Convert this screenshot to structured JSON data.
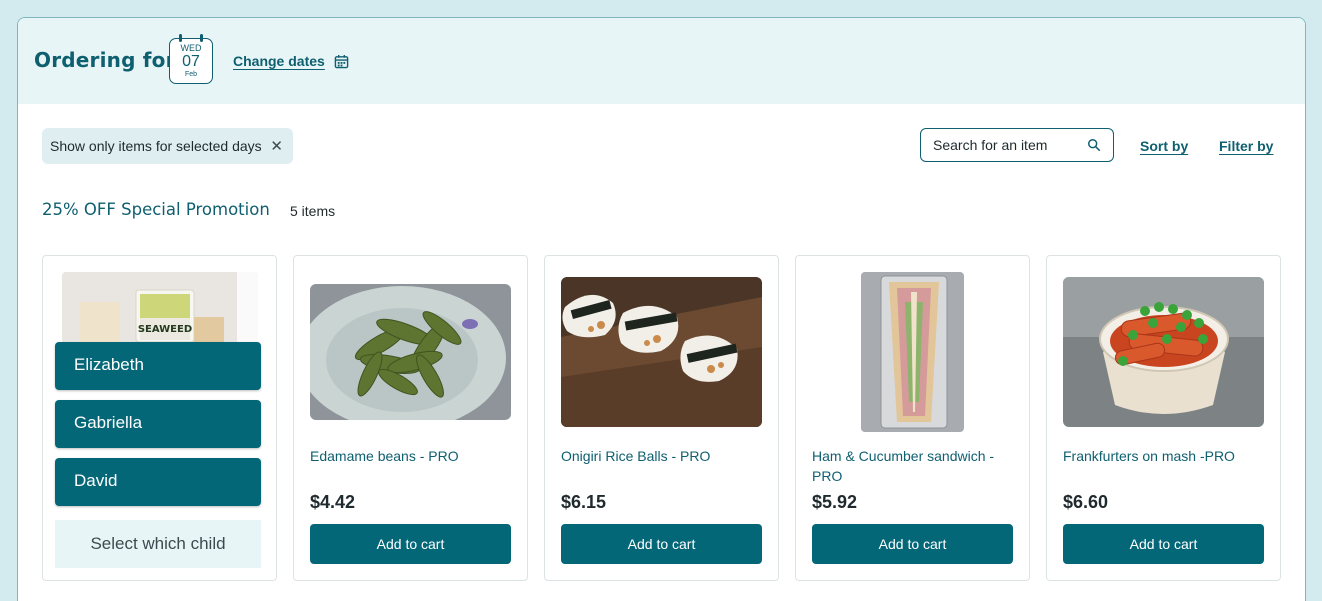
{
  "header": {
    "ordering_label": "Ordering for",
    "date": {
      "day_of_week": "WED",
      "day": "07",
      "month": "Feb"
    },
    "change_dates_label": "Change dates",
    "calendar_icon": "calendar-icon"
  },
  "toolbar": {
    "filter_chip_label": "Show only items for selected days",
    "search_placeholder": "Search for an item",
    "sort_label": "Sort by",
    "filter_label": "Filter by"
  },
  "section": {
    "title": "25% OFF Special Promotion",
    "count": "5 items"
  },
  "child_selector": {
    "children": [
      "Elizabeth",
      "Gabriella",
      "David"
    ],
    "prompt": "Select which child"
  },
  "products": [
    {
      "name": "Edamame beans - PRO",
      "price": "$4.42",
      "button": "Add to cart"
    },
    {
      "name": "Onigiri Rice Balls - PRO",
      "price": "$6.15",
      "button": "Add to cart"
    },
    {
      "name": "Ham & Cucumber sandwich - PRO",
      "price": "$5.92",
      "button": "Add to cart"
    },
    {
      "name": "Frankfurters on mash -PRO",
      "price": "$6.60",
      "button": "Add to cart"
    }
  ],
  "colors": {
    "brand": "#036778",
    "accent_text": "#0e5f70",
    "page_bg": "#d3ebee",
    "header_bg": "#e8f5f6"
  }
}
